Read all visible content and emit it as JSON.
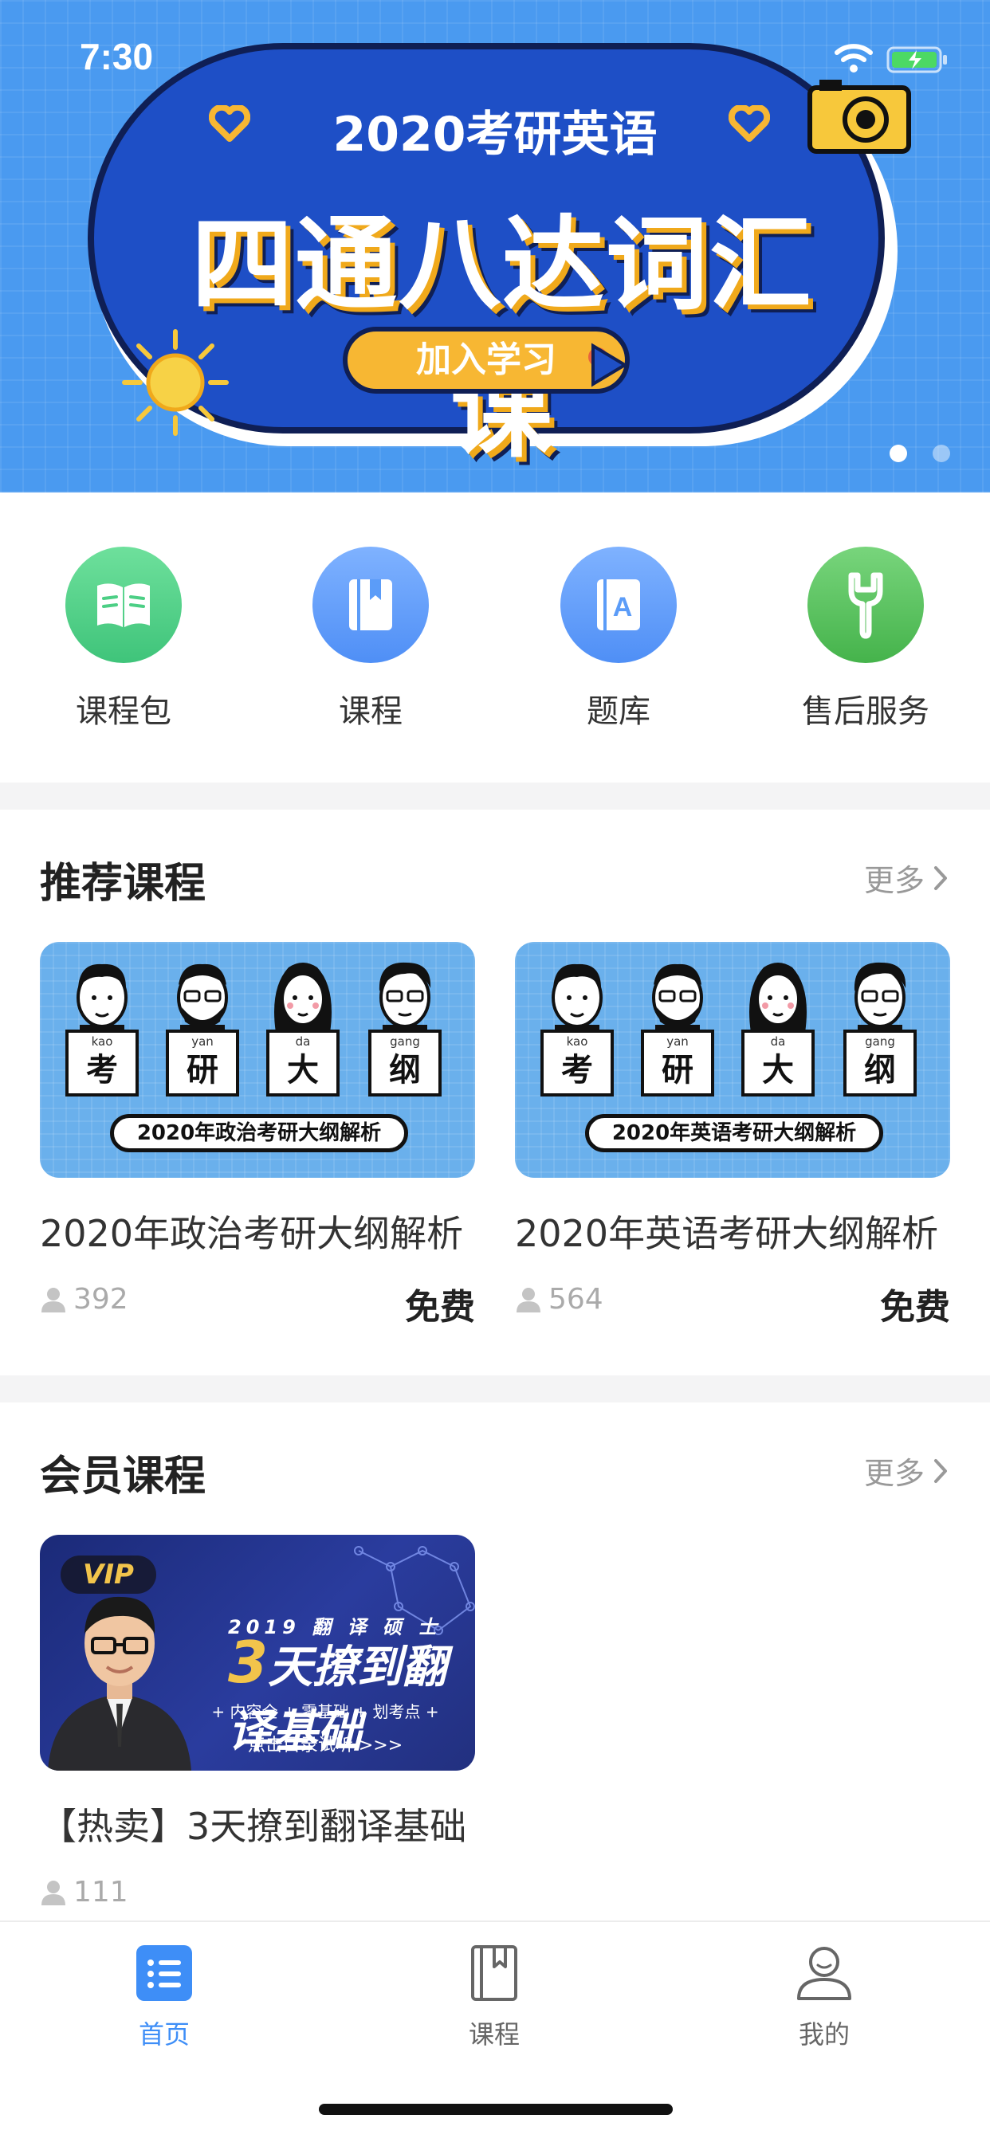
{
  "status_bar": {
    "time": "7:30"
  },
  "banner": {
    "heading": "2020考研英语",
    "title": "四通八达词汇课",
    "cta": "加入学习",
    "page_count": 2,
    "active_page": 1
  },
  "quick_menu": [
    {
      "label": "课程包",
      "icon": "book-open-icon",
      "color": "#4ccf85"
    },
    {
      "label": "课程",
      "icon": "bookmark-book-icon",
      "color": "#5b9cf8"
    },
    {
      "label": "题库",
      "icon": "question-bank-icon",
      "color": "#5b9cf8"
    },
    {
      "label": "售后服务",
      "icon": "wrench-icon",
      "color": "#5ac35f"
    }
  ],
  "recommended": {
    "title": "推荐课程",
    "more": "更多",
    "courses": [
      {
        "title": "2020年政治考研大纲解析",
        "thumb_caption": "2020年政治考研大纲解析",
        "students": "392",
        "price": "免费",
        "signs": [
          {
            "pinyin": "kao",
            "char": "考"
          },
          {
            "pinyin": "yan",
            "char": "研"
          },
          {
            "pinyin": "da",
            "char": "大"
          },
          {
            "pinyin": "gang",
            "char": "纲"
          }
        ]
      },
      {
        "title": "2020年英语考研大纲解析",
        "thumb_caption": "2020年英语考研大纲解析",
        "students": "564",
        "price": "免费",
        "signs": [
          {
            "pinyin": "kao",
            "char": "考"
          },
          {
            "pinyin": "yan",
            "char": "研"
          },
          {
            "pinyin": "da",
            "char": "大"
          },
          {
            "pinyin": "gang",
            "char": "纲"
          }
        ]
      }
    ]
  },
  "member": {
    "title": "会员课程",
    "more": "更多",
    "courses": [
      {
        "title": "【热卖】3天撩到翻译基础",
        "students": "111",
        "thumb": {
          "badge": "VIP",
          "line1": "2019 翻 译 硕 士",
          "line2_num": "3",
          "line2": "天撩到翻译基础",
          "line3": "+ 内容全 + 零基础 + 划考点 +",
          "line4": "点击目录试听 >>>"
        }
      }
    ]
  },
  "tabbar": [
    {
      "label": "首页",
      "icon": "home-list-icon",
      "active": true
    },
    {
      "label": "课程",
      "icon": "book-icon",
      "active": false
    },
    {
      "label": "我的",
      "icon": "user-icon",
      "active": false
    }
  ],
  "colors": {
    "accent": "#3e8ef7",
    "banner_bg": "#4a9af0"
  }
}
